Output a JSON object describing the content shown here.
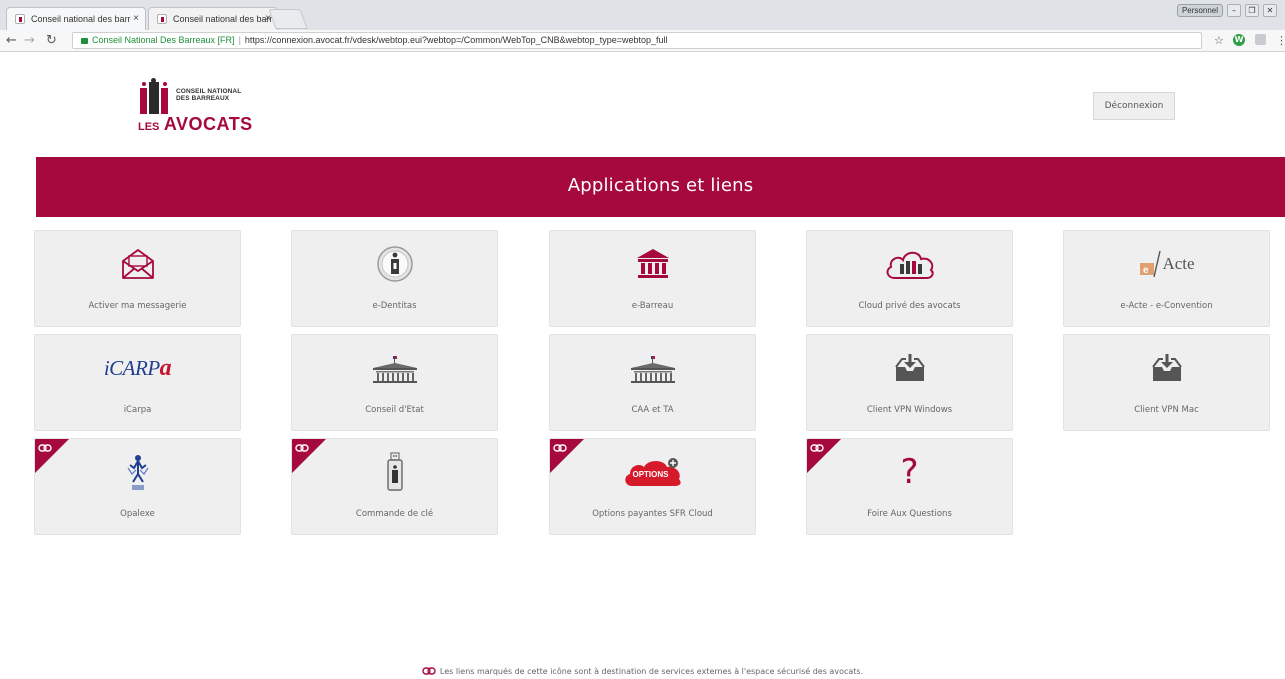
{
  "browser": {
    "tabs": [
      {
        "title": "Conseil national des barr",
        "close": "×"
      },
      {
        "title": "Conseil national des barr",
        "close": "×"
      }
    ],
    "user_button": "Personnel",
    "window_buttons": [
      "–",
      "❐",
      "✕"
    ],
    "nav": {
      "back": "←",
      "forward": "→",
      "reload": "↻"
    },
    "address": {
      "site": "Conseil National Des Barreaux [FR]",
      "separator": "|",
      "url": "https://connexion.avocat.fr/vdesk/webtop.eui?webtop=/Common/WebTop_CNB&webtop_type=webtop_full"
    },
    "extensions": {
      "star": "☆",
      "w": "W",
      "menu": "⋮"
    }
  },
  "header": {
    "logo": {
      "line1": "CONSEIL NATIONAL",
      "line2": "DES BARREAUX",
      "les": "LES",
      "avocats": "AVOCATS"
    },
    "logout_label": "Déconnexion"
  },
  "banner": {
    "title": "Applications et liens"
  },
  "tiles": [
    {
      "label": "Activer ma messagerie",
      "icon": "envelope-icon",
      "external": false
    },
    {
      "label": "e-Dentitas",
      "icon": "edentitas-icon",
      "external": false
    },
    {
      "label": "e-Barreau",
      "icon": "courthouse-icon",
      "external": false
    },
    {
      "label": "Cloud privé des avocats",
      "icon": "cloud-icon",
      "external": false
    },
    {
      "label": "e-Acte - e-Convention",
      "icon": "eacte-icon",
      "external": false,
      "logo_text": "Acte"
    },
    {
      "label": "iCarpa",
      "icon": "icarpa-logo",
      "external": false,
      "logo_text": "iCARPa"
    },
    {
      "label": "Conseil d'Etat",
      "icon": "palais-icon",
      "external": false
    },
    {
      "label": "CAA et TA",
      "icon": "palais-icon",
      "external": false
    },
    {
      "label": "Client VPN Windows",
      "icon": "download-tray-icon",
      "external": false
    },
    {
      "label": "Client VPN Mac",
      "icon": "download-tray-icon",
      "external": false
    },
    {
      "label": "Opalexe",
      "icon": "opalexe-icon",
      "external": true
    },
    {
      "label": "Commande de clé",
      "icon": "usb-key-icon",
      "external": true
    },
    {
      "label": "Options payantes SFR Cloud",
      "icon": "options-cloud-icon",
      "external": true,
      "logo_text": "OPTIONS"
    },
    {
      "label": "Foire Aux Questions",
      "icon": "question-icon",
      "external": true,
      "logo_text": "?"
    }
  ],
  "footnote": "Les liens marqués de cette icône sont à destination de services externes à l'espace sécurisé des avocats.",
  "colors": {
    "brand": "#a6093d",
    "tile_bg": "#efefef",
    "text": "#666666"
  }
}
